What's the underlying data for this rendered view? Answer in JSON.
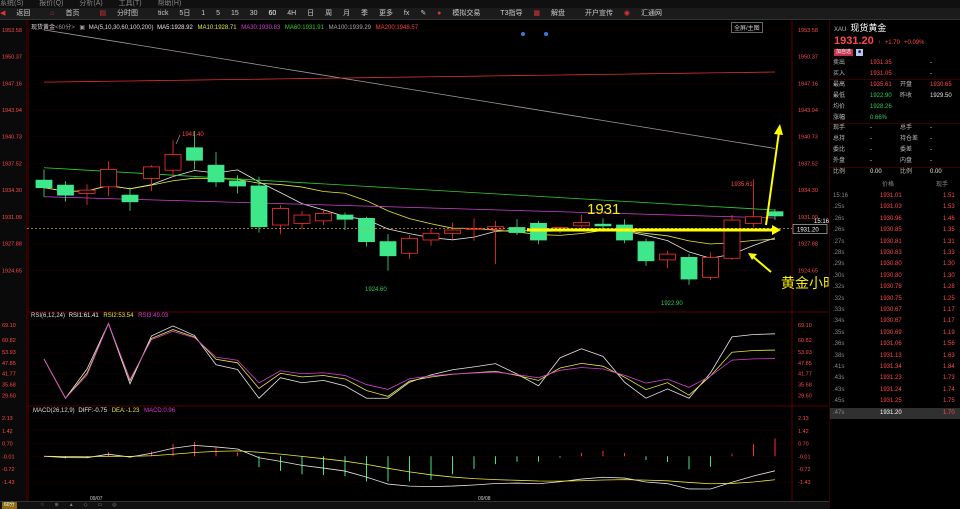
{
  "menubar": [
    "系统(S)",
    "报价(Q)",
    "分析(A)",
    "工具(T)",
    "帮助(H)"
  ],
  "toolbar": {
    "back": "返回",
    "home": "首页",
    "kline": "分时图",
    "tick": "tick",
    "periods": [
      "5日",
      "1",
      "5",
      "15",
      "30",
      "60",
      "4H",
      "日",
      "周",
      "月",
      "季",
      "更多"
    ],
    "fx": "fx",
    "sim": "模拟交易",
    "tools": "T3指导",
    "cut": "解盘",
    "forum": "开户宣传",
    "chat": "汇通网"
  },
  "chart_header": {
    "symbol": "现货黄金",
    "period": "60分",
    "ma_title": "MA(5,10,30,60,100,200)",
    "ma5": "MA5:1928.92",
    "ma10": "MA10:1928.71",
    "ma30": "MA30:1930.83",
    "ma60": "MA60:1931.91",
    "ma100": "MA100:1939.29",
    "ma200": "MA200:1948.57",
    "top_right": "全屏/主图"
  },
  "price_axis": [
    "1953.58",
    "1950.37",
    "1947.16",
    "1943.94",
    "1940.73",
    "1937.52",
    "1934.30",
    "1931.09",
    "1927.88",
    "1924.65"
  ],
  "price_axis_right": [
    "1953.58",
    "1950.37",
    "1947.16",
    "1943.94",
    "1940.73",
    "1937.52",
    "1934.30",
    "1931.09",
    "1927.88",
    "1924.65"
  ],
  "annotations": {
    "high": "1941.40",
    "low1": "1924.60",
    "low2": "1922.90",
    "recent_high": "1935.61",
    "big_label": "1931",
    "caption": "黄金小时图短期均线金叉",
    "price_tag": "1931.20",
    "time_tag": "15:16"
  },
  "rsi": {
    "title": "RSI(6,12,24)",
    "rsi1": "RSI1:61.41",
    "rsi2": "RSI2:53.54",
    "rsi3": "RSI3:49.03",
    "axis": [
      "69.10",
      "60.82",
      "53.93",
      "47.85",
      "41.77",
      "35.68",
      "29.60"
    ]
  },
  "macd": {
    "title": "MACD(26,12,9)",
    "diff": "DIFF:-0.75",
    "dea": "DEA:-1.23",
    "macd": "MACD:0.96",
    "axis": [
      "2.13",
      "1.42",
      "0.70",
      "-0.01",
      "-0.72",
      "-1.43"
    ]
  },
  "dates": [
    "09/07",
    "09/08"
  ],
  "status": {
    "period": "60分"
  },
  "quote": {
    "code": "XAU",
    "name": "现货黄金",
    "price": "1931.20",
    "arrow": "↑",
    "change": "+1.70",
    "change_pct": "+0.09%",
    "btn1": "加自选",
    "btn2": "■",
    "rows": [
      {
        "l1": "卖出",
        "v1": "1931.35",
        "l2": "",
        "v2": "-"
      },
      {
        "l1": "买入",
        "v1": "1931.05",
        "l2": "",
        "v2": "-"
      },
      {
        "l1": "最高",
        "v1": "1935.61",
        "l2": "开盘",
        "v2": "1930.65"
      },
      {
        "l1": "最低",
        "v1": "1922.90",
        "l2": "昨收",
        "v2": "1929.50"
      },
      {
        "l1": "均价",
        "v1": "1928.26",
        "l2": "",
        "v2": ""
      },
      {
        "l1": "涨幅",
        "v1": "0.66%",
        "l2": "",
        "v2": ""
      },
      {
        "l1": "现手",
        "v1": "-",
        "l2": "总手",
        "v2": "-"
      },
      {
        "l1": "总持",
        "v1": "-",
        "l2": "持仓差",
        "v2": "-"
      },
      {
        "l1": "委比",
        "v1": "-",
        "l2": "委差",
        "v2": "-"
      },
      {
        "l1": "外盘",
        "v1": "-",
        "l2": "内盘",
        "v2": "-"
      },
      {
        "l1": "比例",
        "v1": "0.00",
        "l2": "比例",
        "v2": "0.00"
      }
    ],
    "trade_headers": [
      "价格",
      "现手"
    ],
    "trades": [
      {
        "t": "15:16",
        "p": "1931.01",
        "v": "1.51"
      },
      {
        "t": ".25s",
        "p": "1931.03",
        "v": "1.53"
      },
      {
        "t": ".26s",
        "p": "1930.96",
        "v": "1.46"
      },
      {
        "t": ".26s",
        "p": "1930.85",
        "v": "1.35"
      },
      {
        "t": ".27s",
        "p": "1930.81",
        "v": "1.31"
      },
      {
        "t": ".28s",
        "p": "1930.83",
        "v": "1.33"
      },
      {
        "t": ".29s",
        "p": "1930.80",
        "v": "1.30"
      },
      {
        "t": ".30s",
        "p": "1930.80",
        "v": "1.30"
      },
      {
        "t": ".32s",
        "p": "1930.78",
        "v": "1.28"
      },
      {
        "t": ".32s",
        "p": "1930.75",
        "v": "1.25"
      },
      {
        "t": ".33s",
        "p": "1930.67",
        "v": "1.17"
      },
      {
        "t": ".34s",
        "p": "1930.67",
        "v": "1.17"
      },
      {
        "t": ".35s",
        "p": "1930.69",
        "v": "1.19"
      },
      {
        "t": ".36s",
        "p": "1931.06",
        "v": "1.56"
      },
      {
        "t": ".38s",
        "p": "1931.13",
        "v": "1.63"
      },
      {
        "t": ".41s",
        "p": "1931.34",
        "v": "1.84"
      },
      {
        "t": ".43s",
        "p": "1931.23",
        "v": "1.73"
      },
      {
        "t": ".43s",
        "p": "1931.24",
        "v": "1.74"
      },
      {
        "t": ".45s",
        "p": "1931.25",
        "v": "1.75"
      },
      {
        "t": ".47s",
        "p": "1931.20",
        "v": "1.70"
      }
    ]
  },
  "chart_data": {
    "type": "candlestick",
    "candles": [
      {
        "o": 1935.5,
        "h": 1936.8,
        "c": 1934.6,
        "l": 1933.5
      },
      {
        "o": 1934.9,
        "h": 1935.4,
        "c": 1933.7,
        "l": 1932.9
      },
      {
        "o": 1933.9,
        "h": 1935.0,
        "c": 1934.3,
        "l": 1932.5
      },
      {
        "o": 1934.7,
        "h": 1937.8,
        "c": 1936.8,
        "l": 1933.6
      },
      {
        "o": 1933.7,
        "h": 1934.6,
        "c": 1932.9,
        "l": 1931.8
      },
      {
        "o": 1935.7,
        "h": 1937.3,
        "c": 1937.1,
        "l": 1934.2
      },
      {
        "o": 1936.7,
        "h": 1940.3,
        "c": 1938.6,
        "l": 1935.9
      },
      {
        "o": 1939.4,
        "h": 1941.4,
        "c": 1937.9,
        "l": 1936.8
      },
      {
        "o": 1937.3,
        "h": 1938.9,
        "c": 1935.3,
        "l": 1934.7
      },
      {
        "o": 1935.4,
        "h": 1936.1,
        "c": 1934.8,
        "l": 1933.9
      },
      {
        "o": 1934.8,
        "h": 1935.9,
        "c": 1929.9,
        "l": 1929.2
      },
      {
        "o": 1930.1,
        "h": 1932.5,
        "c": 1932.1,
        "l": 1929.0
      },
      {
        "o": 1930.3,
        "h": 1931.8,
        "c": 1931.3,
        "l": 1929.6
      },
      {
        "o": 1930.6,
        "h": 1931.9,
        "c": 1931.5,
        "l": 1930.1
      },
      {
        "o": 1931.3,
        "h": 1931.6,
        "c": 1930.8,
        "l": 1929.5
      },
      {
        "o": 1930.9,
        "h": 1931.1,
        "c": 1928.1,
        "l": 1927.5
      },
      {
        "o": 1928.1,
        "h": 1929.0,
        "c": 1926.4,
        "l": 1924.6
      },
      {
        "o": 1926.7,
        "h": 1928.9,
        "c": 1928.5,
        "l": 1926.0
      },
      {
        "o": 1928.3,
        "h": 1929.7,
        "c": 1929.1,
        "l": 1927.6
      },
      {
        "o": 1929.1,
        "h": 1930.4,
        "c": 1929.5,
        "l": 1928.4
      },
      {
        "o": 1929.6,
        "h": 1930.9,
        "c": 1929.7,
        "l": 1928.2
      },
      {
        "o": 1929.6,
        "h": 1930.6,
        "c": 1929.9,
        "l": 1925.4
      },
      {
        "o": 1929.8,
        "h": 1930.8,
        "c": 1929.2,
        "l": 1928.9
      },
      {
        "o": 1930.3,
        "h": 1930.6,
        "c": 1928.3,
        "l": 1927.8
      },
      {
        "o": 1929.5,
        "h": 1929.9,
        "c": 1929.8,
        "l": 1929.1
      },
      {
        "o": 1930.0,
        "h": 1931.3,
        "c": 1930.4,
        "l": 1929.8
      },
      {
        "o": 1930.2,
        "h": 1930.9,
        "c": 1930.0,
        "l": 1929.3
      },
      {
        "o": 1930.1,
        "h": 1930.8,
        "c": 1928.3,
        "l": 1927.9
      },
      {
        "o": 1928.1,
        "h": 1928.5,
        "c": 1925.8,
        "l": 1925.2
      },
      {
        "o": 1925.9,
        "h": 1927.0,
        "c": 1926.6,
        "l": 1924.9
      },
      {
        "o": 1926.2,
        "h": 1926.6,
        "c": 1923.6,
        "l": 1922.9
      },
      {
        "o": 1923.8,
        "h": 1926.8,
        "c": 1926.2,
        "l": 1923.5
      },
      {
        "o": 1926.1,
        "h": 1931.3,
        "c": 1930.7,
        "l": 1925.9
      },
      {
        "o": 1930.3,
        "h": 1935.6,
        "c": 1931.1,
        "l": 1929.8
      },
      {
        "o": 1931.7,
        "h": 1932.0,
        "c": 1931.2,
        "l": 1930.7
      }
    ],
    "ylim": [
      1923.0,
      1953.58
    ]
  }
}
